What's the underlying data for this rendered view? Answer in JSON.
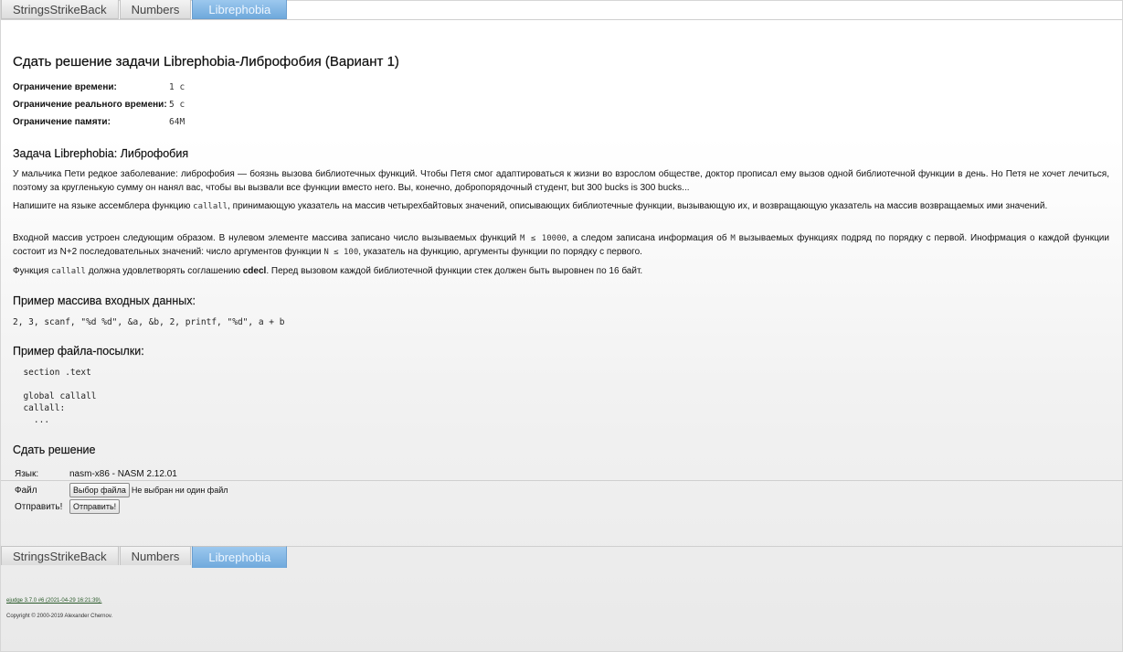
{
  "tabs": [
    {
      "label": "StringsStrikeBack",
      "active": false
    },
    {
      "label": "Numbers",
      "active": false
    },
    {
      "label": "Librephobia",
      "active": true
    }
  ],
  "page_title": "Сдать решение задачи Librephobia-Либрофобия (Вариант 1)",
  "limits": [
    {
      "label": "Ограничение времени:",
      "value": "1 с"
    },
    {
      "label": "Ограничение реального времени:",
      "value": "5 с"
    },
    {
      "label": "Ограничение памяти:",
      "value": "64M"
    }
  ],
  "problem": {
    "heading": "Задача Librephobia: Либрофобия",
    "p1": "У мальчика Пети редкое заболевание: либрофобия — боязнь вызова библиотечных функций. Чтобы Петя смог адаптироваться к жизни во взрослом обществе, доктор прописал ему вызов одной библиотечной функции в день. Но Петя не хочет лечиться, поэтому за кругленькую сумму он нанял вас, чтобы вы вызвали все функции вместо него. Вы, конечно, добропорядочный студент, but 300 bucks is 300 bucks...",
    "p2": {
      "before": "Напишите на языке ассемблера функцию ",
      "code": "callall",
      "after": ", принимающую указатель на массив четырехбайтовых значений, описывающих библиотечные функции, вызывающую их, и возвращающую указатель на массив возвращаемых ими значений."
    },
    "p3": {
      "t1": "Входной массив устроен следующим образом. В нулевом элементе массива записано число вызываемых функций ",
      "c1": "M ≤ 10000",
      "t2": ", а следом записана информация об ",
      "c2": "M",
      "t3": " вызываемых функциях подряд по порядку с первой. Инофрмация о каждой функции состоит из N+2 последовательных значений: число аргументов функции ",
      "c3": "N ≤ 100",
      "t4": ", указатель на функцию, аргументы функции по порядку с первого."
    },
    "p4": {
      "t1": "Функция ",
      "c1": "callall",
      "t2": " должна удовлетворять соглашению ",
      "b1": "cdecl",
      "t3": ". Перед вызовом каждой библиотечной функции стек должен быть выровнен по 16 байт."
    }
  },
  "example_input": {
    "heading": "Пример массива входных данных:",
    "code": "2, 3, scanf, \"%d %d\", &a, &b, 2, printf, \"%d\", a + b"
  },
  "example_file": {
    "heading": "Пример файла-посылки:",
    "code": "  section .text\n\n  global callall\n  callall:\n    ..."
  },
  "submit": {
    "heading": "Сдать решение",
    "lang_label": "Язык:",
    "lang_value": "nasm-x86 - NASM 2.12.01",
    "file_label": "Файл",
    "file_button": "Выбор файла",
    "file_status": "Не выбран ни один файл",
    "send_label": "Отправить!",
    "send_button": "Отправить!"
  },
  "footer": {
    "version": "ejudge 3.7.0 #6 (2021-04-29 16:21:39).",
    "copyright": "Copyright © 2000-2019 Alexander Chernov."
  }
}
